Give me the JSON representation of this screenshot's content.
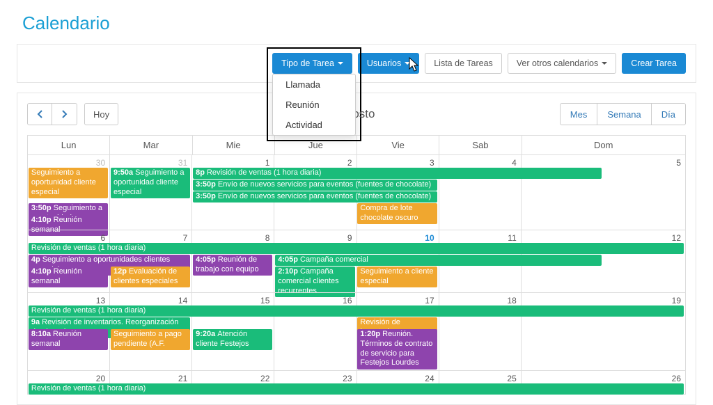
{
  "pageTitle": "Calendario",
  "toolbar": {
    "tipoTarea": "Tipo de Tarea",
    "usuarios": "Usuarios",
    "listaTareas": "Lista de Tareas",
    "verOtros": "Ver otros calendarios",
    "crearTarea": "Crear Tarea"
  },
  "dropdown": {
    "items": [
      "Llamada",
      "Reunión",
      "Actividad"
    ]
  },
  "nav": {
    "today": "Hoy",
    "monthLabel": "Agosto",
    "views": [
      "Mes",
      "Semana",
      "Día"
    ]
  },
  "dow": [
    "Lun",
    "Mar",
    "Mie",
    "Jue",
    "Vie",
    "Sab",
    "Dom"
  ],
  "weeks": [
    {
      "days": [
        {
          "n": 30,
          "other": true
        },
        {
          "n": 31,
          "other": true
        },
        {
          "n": 1
        },
        {
          "n": 2
        },
        {
          "n": 3
        },
        {
          "n": 4
        },
        {
          "n": 5
        }
      ]
    },
    {
      "days": [
        {
          "n": 6
        },
        {
          "n": 7
        },
        {
          "n": 8
        },
        {
          "n": 9
        },
        {
          "n": 10,
          "today": true
        },
        {
          "n": 11
        },
        {
          "n": 12
        }
      ]
    },
    {
      "days": [
        {
          "n": 13
        },
        {
          "n": 14
        },
        {
          "n": 15
        },
        {
          "n": 16
        },
        {
          "n": 17
        },
        {
          "n": 18
        },
        {
          "n": 19
        }
      ]
    },
    {
      "days": [
        {
          "n": 20
        },
        {
          "n": 21
        },
        {
          "n": 22
        },
        {
          "n": 23
        },
        {
          "n": 24
        },
        {
          "n": 25
        },
        {
          "n": 26
        }
      ]
    }
  ],
  "events": {
    "w0": [
      {
        "c": "orange",
        "row": 0,
        "col": 0,
        "span": 1,
        "text": "Seguimiento a oportunidad cliente especial",
        "h": 3
      },
      {
        "c": "green",
        "row": 0,
        "col": 1,
        "span": 1,
        "time": "9:50a",
        "text": "Seguimiento a oportunidad cliente especial",
        "h": 3
      },
      {
        "c": "green",
        "row": 0,
        "col": 2,
        "span": 5,
        "time": "8p",
        "text": "Revisión de ventas (1 hora diaria)"
      },
      {
        "c": "green",
        "row": 1,
        "col": 2,
        "span": 3,
        "time": "3:50p",
        "text": "Envío de nuevos servicios para eventos (fuentes de chocolate)"
      },
      {
        "c": "green",
        "row": 2,
        "col": 2,
        "span": 3,
        "time": "3:50p",
        "text": "Envío de nuevos servicios para eventos (fuentes de chocolate)"
      },
      {
        "c": "orange",
        "row": 3,
        "col": 4,
        "span": 1,
        "text": "Compra de lote chocolate oscuro",
        "h": 2
      },
      {
        "c": "purple",
        "row": 3,
        "col": 0,
        "span": 1,
        "time": "3:50p",
        "text": "Seguimiento a oportunidades"
      },
      {
        "c": "purple",
        "row": 4,
        "col": 0,
        "span": 1,
        "time": "4:10p",
        "text": "Reunión semanal"
      }
    ],
    "w1": [
      {
        "c": "green",
        "row": 0,
        "col": 0,
        "span": 7,
        "text": "Revisión de ventas (1 hora diaria)"
      },
      {
        "c": "purple",
        "row": 1,
        "col": 0,
        "span": 2,
        "time": "4p",
        "text": "Seguimiento a oportunidades clientes especiales"
      },
      {
        "c": "purple",
        "row": 1,
        "col": 2,
        "span": 1,
        "time": "4:05p",
        "text": "Reunión de trabajo con equipo",
        "h": 2
      },
      {
        "c": "green",
        "row": 1,
        "col": 3,
        "span": 4,
        "time": "4:05p",
        "text": "Campaña comercial"
      },
      {
        "c": "purple",
        "row": 2,
        "col": 0,
        "span": 1,
        "time": "4:10p",
        "text": "Reunión semanal"
      },
      {
        "c": "orange",
        "row": 2,
        "col": 1,
        "span": 1,
        "time": "12p",
        "text": "Evaluación de clientes especiales",
        "h": 2
      },
      {
        "c": "green",
        "row": 2,
        "col": 3,
        "span": 1,
        "time": "2:10p",
        "text": "Campaña comercial clientes recurrentes",
        "h": 3
      },
      {
        "c": "orange",
        "row": 2,
        "col": 4,
        "span": 1,
        "text": "Seguimiento a cliente especial",
        "h": 2
      }
    ],
    "w2": [
      {
        "c": "green",
        "row": 0,
        "col": 0,
        "span": 7,
        "text": "Revisión de ventas (1 hora diaria)"
      },
      {
        "c": "green",
        "row": 1,
        "col": 0,
        "span": 2,
        "time": "9a",
        "text": "Revisión de inventarios. Reorganización de almacén"
      },
      {
        "c": "orange",
        "row": 1,
        "col": 4,
        "span": 1,
        "text": "Revisión de inventario"
      },
      {
        "c": "purple",
        "row": 2,
        "col": 0,
        "span": 1,
        "time": "8:10a",
        "text": "Reunión semanal"
      },
      {
        "c": "orange",
        "row": 2,
        "col": 1,
        "span": 1,
        "text": "Seguimiento a pago pendiente (A.F. Lourdes)",
        "h": 2
      },
      {
        "c": "green",
        "row": 2,
        "col": 2,
        "span": 1,
        "time": "9:20a",
        "text": "Atención cliente Festejos Lourdes",
        "h": 2
      },
      {
        "c": "purple",
        "row": 2,
        "col": 4,
        "span": 1,
        "time": "1:20p",
        "text": "Reunión. Términos de contrato de servicio para Festejos Lourdes",
        "h": 4
      }
    ],
    "w3": [
      {
        "c": "green",
        "row": 0,
        "col": 0,
        "span": 7,
        "text": "Revisión de ventas (1 hora diaria)"
      }
    ]
  }
}
